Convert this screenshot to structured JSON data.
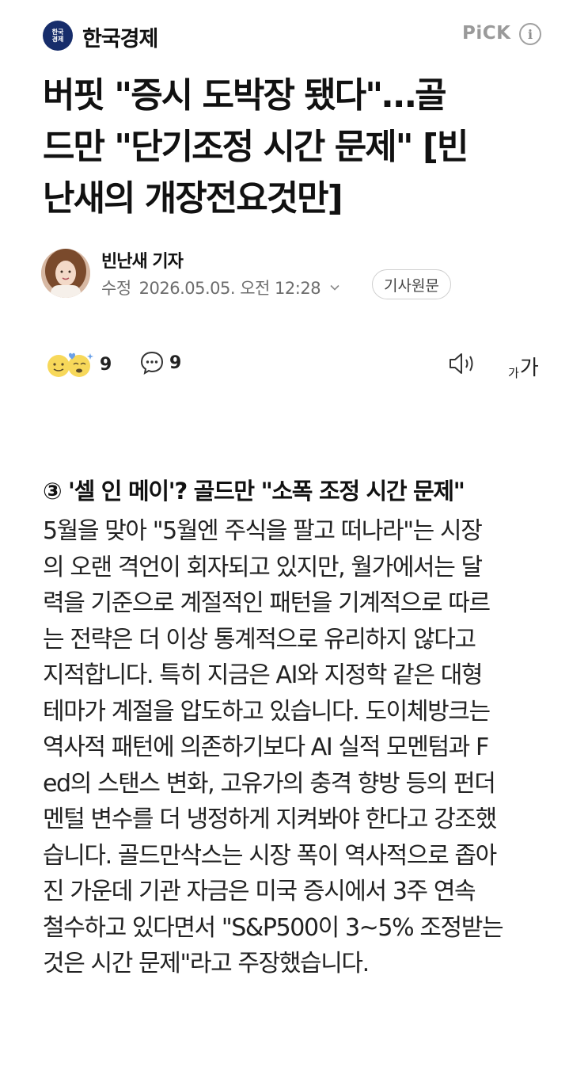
{
  "header": {
    "logo_line1": "한국",
    "logo_line2": "경제",
    "press_name": "한국경제",
    "pick_label": "PiCK",
    "info_icon": "info-icon"
  },
  "headline": {
    "line1": "버핏 \"증시 도박장 됐다\"…골",
    "line2": "드만 \"단기조정 시간 문제\" [빈",
    "line3": "난새의 개장전요것만]"
  },
  "byline": {
    "reporter": "빈난새 기자",
    "date_label": "수정",
    "date": "2026.05.05. 오전 12:28",
    "original_button": "기사원문"
  },
  "actions": {
    "reaction_count": "9",
    "comment_count": "9",
    "tts_icon": "speaker-icon",
    "font_small": "가",
    "font_big": "가"
  },
  "article": {
    "subhead": "③ '셀 인 메이'? 골드만 \"소폭 조정 시간 문제\"",
    "lines": [
      "5월을 맞아 \"5월엔 주식을 팔고 떠나라\"는 시장",
      "의 오랜 격언이 회자되고 있지만, 월가에서는 달",
      "력을 기준으로 계절적인 패턴을 기계적으로 따르",
      "는 전략은 더 이상 통계적으로 유리하지 않다고",
      "지적합니다. 특히 지금은 AI와 지정학 같은 대형",
      "테마가 계절을 압도하고 있습니다. 도이체방크는",
      "역사적 패턴에 의존하기보다 AI 실적 모멘텀과 F",
      "ed의 스탠스 변화, 고유가의 충격 향방 등의 펀더",
      "멘털 변수를 더 냉정하게 지켜봐야 한다고 강조했",
      "습니다. 골드만삭스는 시장 폭이 역사적으로 좁아",
      "진 가운데 기관 자금은 미국 증시에서 3주 연속",
      "철수하고 있다면서 \"S&P500이 3~5% 조정받는",
      "것은 시간 문제\"라고 주장했습니다."
    ]
  }
}
